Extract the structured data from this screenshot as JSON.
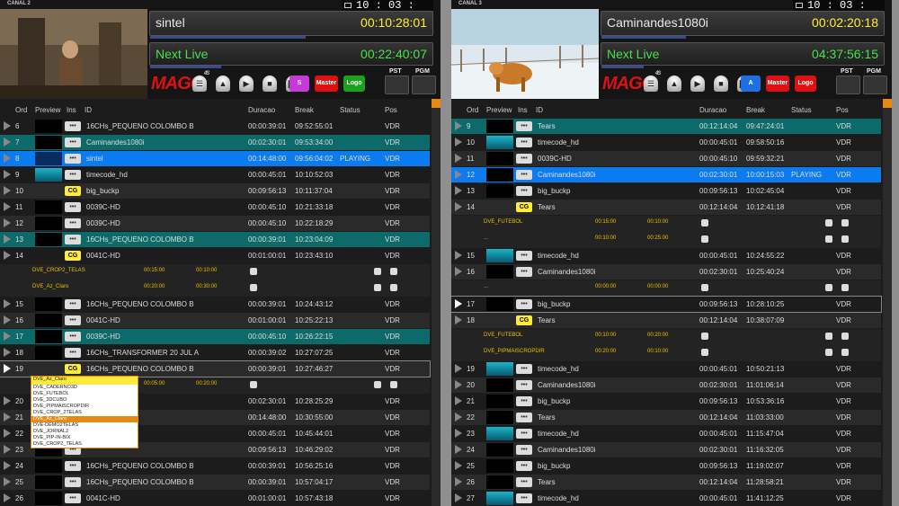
{
  "panels": [
    {
      "canal": "CANAL 2",
      "clock": "10 : 03 : 23",
      "clock_suffix": "LT",
      "current": {
        "title": "sintel",
        "time": "00:10:28:01",
        "progress": 0.55
      },
      "next": {
        "title": "Next Live",
        "time": "00:22:40:07",
        "progress": 0.25
      },
      "logo": "MAGO",
      "logo_sup": "4S",
      "buttons": [
        "S",
        "Master",
        "Logo"
      ],
      "pst": "PST",
      "pgm": "PGM",
      "cols": [
        "Ord",
        "Preview",
        "Ins",
        "ID",
        "Duracao",
        "Break",
        "Status",
        "Pos"
      ],
      "rows": [
        {
          "t": "row",
          "ord": "6",
          "ins": "•••",
          "id": "16CHs_PEQUENO COLOMBO B",
          "dur": "00:00:39:01",
          "brk": "09:52:55:01",
          "status": "",
          "pos": "VDR",
          "bg": "#1c1c1c",
          "pv": "dark"
        },
        {
          "t": "row",
          "ord": "7",
          "ins": "•••",
          "id": "Caminandes1080i",
          "dur": "00:02:30:01",
          "brk": "09:53:34:00",
          "status": "",
          "pos": "VDR",
          "bg": "#0c6a6a",
          "pv": "dark"
        },
        {
          "t": "row",
          "ord": "8",
          "ins": "•••",
          "id": "sintel",
          "dur": "00:14:48:00",
          "brk": "09:56:04:02",
          "status": "PLAYING",
          "pos": "VDR",
          "bg": "#0d7bf0",
          "pv": "blue"
        },
        {
          "t": "row",
          "ord": "9",
          "ins": "•••",
          "id": "timecode_hd",
          "dur": "00:00:45:01",
          "brk": "10:10:52:03",
          "status": "",
          "pos": "VDR",
          "bg": "#1c1c1c",
          "pv": "cyan"
        },
        {
          "t": "row",
          "ord": "10",
          "ins": "CG",
          "id": "big_buckp",
          "dur": "00:09:56:13",
          "brk": "10:11:37:04",
          "status": "",
          "pos": "VDR",
          "bg": "#2a2a2a",
          "pv": "none"
        },
        {
          "t": "row",
          "ord": "11",
          "ins": "•••",
          "id": "0039C-HD",
          "dur": "00:00:45:10",
          "brk": "10:21:33:18",
          "status": "",
          "pos": "VDR",
          "bg": "#1c1c1c",
          "pv": "dark"
        },
        {
          "t": "row",
          "ord": "12",
          "ins": "•••",
          "id": "0039C-HD",
          "dur": "00:00:45:10",
          "brk": "10:22:18:29",
          "status": "",
          "pos": "VDR",
          "bg": "#2a2a2a",
          "pv": "dark"
        },
        {
          "t": "row",
          "ord": "13",
          "ins": "•••",
          "id": "16CHs_PEQUENO COLOMBO B",
          "dur": "00:00:39:01",
          "brk": "10:23:04:09",
          "status": "",
          "pos": "VDR",
          "bg": "#0c6a6a",
          "pv": "dark"
        },
        {
          "t": "row",
          "ord": "14",
          "ins": "CG",
          "id": "0041C-HD",
          "dur": "00:01:00:01",
          "brk": "10:23:43:10",
          "status": "",
          "pos": "VDR",
          "bg": "#1c1c1c",
          "pv": "none"
        },
        {
          "t": "sub",
          "name": "DVE_CROP2_TELAS",
          "a": "00:15:00",
          "b": "00:10:00"
        },
        {
          "t": "sub",
          "name": "DVE_Az_Claro",
          "a": "00:20:00",
          "b": "00:30:00"
        },
        {
          "t": "row",
          "ord": "15",
          "ins": "•••",
          "id": "16CHs_PEQUENO COLOMBO B",
          "dur": "00:00:39:01",
          "brk": "10:24:43:12",
          "status": "",
          "pos": "VDR",
          "bg": "#1c1c1c",
          "pv": "dark"
        },
        {
          "t": "row",
          "ord": "16",
          "ins": "•••",
          "id": "0041C-HD",
          "dur": "00:01:00:01",
          "brk": "10:25:22:13",
          "status": "",
          "pos": "VDR",
          "bg": "#2a2a2a",
          "pv": "dark"
        },
        {
          "t": "row",
          "ord": "17",
          "ins": "•••",
          "id": "0039C-HD",
          "dur": "00:00:45:10",
          "brk": "10:26:22:15",
          "status": "",
          "pos": "VDR",
          "bg": "#0c6a6a",
          "pv": "dark"
        },
        {
          "t": "row",
          "ord": "18",
          "ins": "•••",
          "id": "16CHs_TRANSFORMER 20 JUL A",
          "dur": "00:00:39:02",
          "brk": "10:27:07:25",
          "status": "",
          "pos": "VDR",
          "bg": "#1c1c1c",
          "pv": "dark"
        },
        {
          "t": "row",
          "ord": "19",
          "ins": "CG",
          "id": "16CHs_PEQUENO COLOMBO B",
          "dur": "00:00:39:01",
          "brk": "10:27:46:27",
          "status": "",
          "pos": "VDR",
          "bg": "#2a2a2a",
          "pv": "none",
          "sel": true
        },
        {
          "t": "sub2",
          "name": "DVE_Az_Claro",
          "a": "00:05:00",
          "b": "00:20:00"
        },
        {
          "t": "row",
          "ord": "20",
          "ins": "•••",
          "id": "0i",
          "dur": "00:02:30:01",
          "brk": "10:28:25:29",
          "status": "",
          "pos": "VDR",
          "bg": "#1c1c1c",
          "pv": "dark"
        },
        {
          "t": "row",
          "ord": "21",
          "ins": "•••",
          "id": "",
          "dur": "00:14:48:00",
          "brk": "10:30:55:00",
          "status": "",
          "pos": "VDR",
          "bg": "#2a2a2a",
          "pv": "dark"
        },
        {
          "t": "row",
          "ord": "22",
          "ins": "•••",
          "id": "",
          "dur": "00:00:45:01",
          "brk": "10:45:44:01",
          "status": "",
          "pos": "VDR",
          "bg": "#1c1c1c",
          "pv": "dark"
        },
        {
          "t": "row",
          "ord": "23",
          "ins": "•••",
          "id": "",
          "dur": "00:09:56:13",
          "brk": "10:46:29:02",
          "status": "",
          "pos": "VDR",
          "bg": "#2a2a2a",
          "pv": "dark"
        },
        {
          "t": "row",
          "ord": "24",
          "ins": "•••",
          "id": "16CHs_PEQUENO COLOMBO B",
          "dur": "00:00:39:01",
          "brk": "10:56:25:16",
          "status": "",
          "pos": "VDR",
          "bg": "#1c1c1c",
          "pv": "dark"
        },
        {
          "t": "row",
          "ord": "25",
          "ins": "•••",
          "id": "16CHs_PEQUENO COLOMBO B",
          "dur": "00:00:39:01",
          "brk": "10:57:04:17",
          "status": "",
          "pos": "VDR",
          "bg": "#2a2a2a",
          "pv": "dark"
        },
        {
          "t": "row",
          "ord": "26",
          "ins": "•••",
          "id": "0041C-HD",
          "dur": "00:01:00:01",
          "brk": "10:57:43:18",
          "status": "",
          "pos": "VDR",
          "bg": "#1c1c1c",
          "pv": "dark"
        }
      ],
      "dropdown": {
        "value": "DVE_Az_Claro",
        "options": [
          "DVE_CADERNO3D",
          "DVE_FUTEBOL",
          "DVE_3DCUBO",
          "DVE_PIPMAISCROPDIR",
          "DVE_CROP_2TELAS",
          "DVE_Az_Claro",
          "DVE-DEMO2TELAS",
          "DVE_JORNAL2",
          "DVE_PIP-IN-BIX",
          "DVE_CROP2_TELAS"
        ]
      }
    },
    {
      "canal": "CANAL 3",
      "clock": "10 : 03 : 23",
      "clock_suffix": "LT",
      "current": {
        "title": "Caminandes1080i",
        "time": "00:02:20:18",
        "progress": 0.3
      },
      "next": {
        "title": "Next Live",
        "time": "04:37:56:15",
        "progress": 0.15
      },
      "logo": "MAGO",
      "logo_sup": "4S",
      "buttons": [
        "A",
        "Master",
        "Logo"
      ],
      "pst": "PST",
      "pgm": "PGM",
      "cols": [
        "Ord",
        "Preview",
        "Ins",
        "ID",
        "Duracao",
        "Break",
        "Status",
        "Pos"
      ],
      "rows": [
        {
          "t": "row",
          "ord": "9",
          "ins": "•••",
          "id": "Tears",
          "dur": "00:12:14:04",
          "brk": "09:47:24:01",
          "status": "",
          "pos": "VDR",
          "bg": "#0c6a6a",
          "pv": "dark"
        },
        {
          "t": "row",
          "ord": "10",
          "ins": "•••",
          "id": "timecode_hd",
          "dur": "00:00:45:01",
          "brk": "09:58:50:16",
          "status": "",
          "pos": "VDR",
          "bg": "#1c1c1c",
          "pv": "cyan"
        },
        {
          "t": "row",
          "ord": "11",
          "ins": "•••",
          "id": "0039C-HD",
          "dur": "00:00:45:10",
          "brk": "09:59:32:21",
          "status": "",
          "pos": "VDR",
          "bg": "#2a2a2a",
          "pv": "dark"
        },
        {
          "t": "row",
          "ord": "12",
          "ins": "•••",
          "id": "Caminandes1080i",
          "dur": "00:02:30:01",
          "brk": "10:00:15:03",
          "status": "PLAYING",
          "pos": "VDR",
          "bg": "#0d7bf0",
          "pv": "dark"
        },
        {
          "t": "row",
          "ord": "13",
          "ins": "•••",
          "id": "big_buckp",
          "dur": "00:09:56:13",
          "brk": "10:02:45:04",
          "status": "",
          "pos": "VDR",
          "bg": "#1c1c1c",
          "pv": "dark"
        },
        {
          "t": "row",
          "ord": "14",
          "ins": "CG",
          "id": "Tears",
          "dur": "00:12:14:04",
          "brk": "10:12:41:18",
          "status": "",
          "pos": "VDR",
          "bg": "#2a2a2a",
          "pv": "none"
        },
        {
          "t": "sub",
          "name": "DVE_FUTEBOL",
          "a": "00:15:00",
          "b": "00:10:00"
        },
        {
          "t": "sub",
          "name": "...",
          "a": "00:10:00",
          "b": "00:25:00"
        },
        {
          "t": "row",
          "ord": "15",
          "ins": "•••",
          "id": "timecode_hd",
          "dur": "00:00:45:01",
          "brk": "10:24:55:22",
          "status": "",
          "pos": "VDR",
          "bg": "#1c1c1c",
          "pv": "cyan"
        },
        {
          "t": "row",
          "ord": "16",
          "ins": "•••",
          "id": "Caminandes1080i",
          "dur": "00:02:30:01",
          "brk": "10:25:40:24",
          "status": "",
          "pos": "VDR",
          "bg": "#2a2a2a",
          "pv": "dark"
        },
        {
          "t": "sub",
          "name": "...",
          "a": "00:00:00",
          "b": "00:00:00"
        },
        {
          "t": "row",
          "ord": "17",
          "ins": "•••",
          "id": "big_buckp",
          "dur": "00:09:56:13",
          "brk": "10:28:10:25",
          "status": "",
          "pos": "VDR",
          "bg": "#1c1c1c",
          "pv": "dark",
          "sel": true
        },
        {
          "t": "row",
          "ord": "18",
          "ins": "CG",
          "id": "Tears",
          "dur": "00:12:14:04",
          "brk": "10:38:07:09",
          "status": "",
          "pos": "VDR",
          "bg": "#2a2a2a",
          "pv": "none"
        },
        {
          "t": "sub",
          "name": "DVE_FUTEBOL",
          "a": "00:10:00",
          "b": "00:20:00"
        },
        {
          "t": "sub",
          "name": "DVE_PIPMAISCROPDIR",
          "a": "00:20:00",
          "b": "00:10:00"
        },
        {
          "t": "row",
          "ord": "19",
          "ins": "•••",
          "id": "timecode_hd",
          "dur": "00:00:45:01",
          "brk": "10:50:21:13",
          "status": "",
          "pos": "VDR",
          "bg": "#1c1c1c",
          "pv": "cyan"
        },
        {
          "t": "row",
          "ord": "20",
          "ins": "•••",
          "id": "Caminandes1080i",
          "dur": "00:02:30:01",
          "brk": "11:01:06:14",
          "status": "",
          "pos": "VDR",
          "bg": "#2a2a2a",
          "pv": "dark"
        },
        {
          "t": "row",
          "ord": "21",
          "ins": "•••",
          "id": "big_buckp",
          "dur": "00:09:56:13",
          "brk": "10:53:36:16",
          "status": "",
          "pos": "VDR",
          "bg": "#1c1c1c",
          "pv": "dark"
        },
        {
          "t": "row",
          "ord": "22",
          "ins": "•••",
          "id": "Tears",
          "dur": "00:12:14:04",
          "brk": "11:03:33:00",
          "status": "",
          "pos": "VDR",
          "bg": "#2a2a2a",
          "pv": "dark"
        },
        {
          "t": "row",
          "ord": "23",
          "ins": "•••",
          "id": "timecode_hd",
          "dur": "00:00:45:01",
          "brk": "11:15:47:04",
          "status": "",
          "pos": "VDR",
          "bg": "#1c1c1c",
          "pv": "cyan"
        },
        {
          "t": "row",
          "ord": "24",
          "ins": "•••",
          "id": "Caminandes1080i",
          "dur": "00:02:30:01",
          "brk": "11:16:32:05",
          "status": "",
          "pos": "VDR",
          "bg": "#2a2a2a",
          "pv": "dark"
        },
        {
          "t": "row",
          "ord": "25",
          "ins": "•••",
          "id": "big_buckp",
          "dur": "00:09:56:13",
          "brk": "11:19:02:07",
          "status": "",
          "pos": "VDR",
          "bg": "#1c1c1c",
          "pv": "dark"
        },
        {
          "t": "row",
          "ord": "26",
          "ins": "•••",
          "id": "Tears",
          "dur": "00:12:14:04",
          "brk": "11:28:58:21",
          "status": "",
          "pos": "VDR",
          "bg": "#2a2a2a",
          "pv": "dark"
        },
        {
          "t": "row",
          "ord": "27",
          "ins": "•••",
          "id": "timecode_hd",
          "dur": "00:00:45:01",
          "brk": "11:41:12:25",
          "status": "",
          "pos": "VDR",
          "bg": "#1c1c1c",
          "pv": "cyan"
        }
      ]
    }
  ]
}
